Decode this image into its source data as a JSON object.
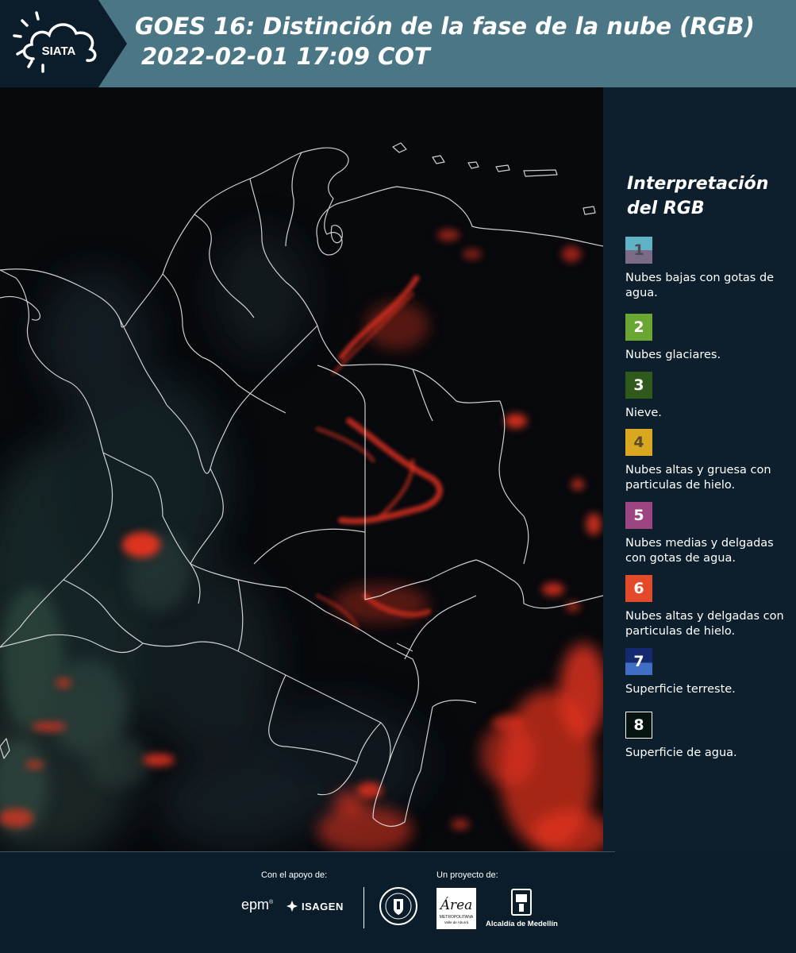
{
  "header": {
    "logo_text": "SIATA",
    "title_line1": "GOES 16: Distinción de la fase de la nube (RGB)",
    "title_line2": "2022-02-01 17:09 COT"
  },
  "legend": {
    "title": "Interpretación del RGB",
    "items": [
      {
        "number": "1",
        "label": "Nubes bajas con gotas de agua.",
        "color_top": "#5fb3c4",
        "color_bottom": "#7a6b87",
        "text_color": "#4a4a58"
      },
      {
        "number": "2",
        "label": "Nubes glaciares.",
        "color_top": "#6aa632",
        "color_bottom": "#6aa632",
        "text_color": "#ffffff"
      },
      {
        "number": "3",
        "label": "Nieve.",
        "color_top": "#2f5a1b",
        "color_bottom": "#2f5a1b",
        "text_color": "#ffffff"
      },
      {
        "number": "4",
        "label": "Nubes altas y gruesa con particulas de hielo.",
        "color_top": "#d9a820",
        "color_bottom": "#d9a820",
        "text_color": "#5a4a2a"
      },
      {
        "number": "5",
        "label": "Nubes medias y delgadas con gotas de agua.",
        "color_top": "#9c4580",
        "color_bottom": "#9c4580",
        "text_color": "#ffffff"
      },
      {
        "number": "6",
        "label": "Nubes altas y delgadas con particulas de hielo.",
        "color_top": "#e24a2a",
        "color_bottom": "#e24a2a",
        "text_color": "#ffffff"
      },
      {
        "number": "7",
        "label": "Superficie terreste.",
        "color_top": "#142a6e",
        "color_bottom": "#3f6ec4",
        "text_color": "#ffffff"
      },
      {
        "number": "8",
        "label": "Superficie de agua.",
        "color_top": "#061410",
        "color_bottom": "#061410",
        "text_color": "#ffffff"
      }
    ]
  },
  "footer": {
    "support_label": "Con el apoyo de:",
    "project_label": "Un proyecto de:",
    "epm": "epm",
    "isagen": "ISAGEN",
    "area_logo_text": "Área",
    "area_logo_sub1": "METROPOLITANA",
    "area_logo_sub2": "Valle de Aburrá",
    "alcaldia": "Alcaldía de Medellín"
  },
  "colors": {
    "header_bg": "#4b7686",
    "logo_bg": "#0b1d2a",
    "panel_bg": "#0d1f2c",
    "map_bg": "#07090d",
    "cloud_red": "#e8331f"
  }
}
